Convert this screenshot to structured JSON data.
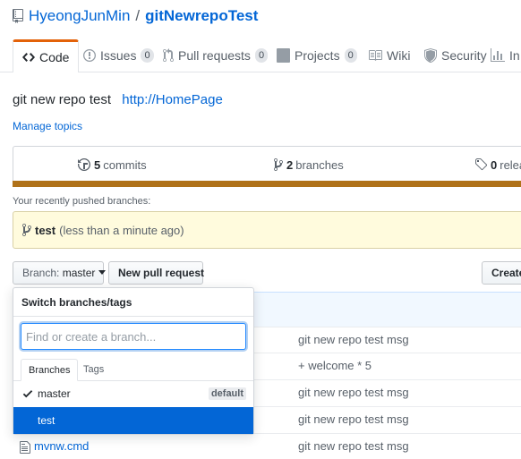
{
  "repo": {
    "owner": "HyeongJunMin",
    "separator": "/",
    "name": "gitNewrepoTest"
  },
  "tabs": [
    {
      "label": "Code",
      "count": null,
      "icon": "code-icon"
    },
    {
      "label": "Issues",
      "count": "0",
      "icon": "issue-icon"
    },
    {
      "label": "Pull requests",
      "count": "0",
      "icon": "pull-request-icon"
    },
    {
      "label": "Projects",
      "count": "0",
      "icon": "project-icon"
    },
    {
      "label": "Wiki",
      "count": null,
      "icon": "wiki-icon"
    },
    {
      "label": "Security",
      "count": null,
      "icon": "shield-icon"
    },
    {
      "label": "In",
      "count": null,
      "icon": "graph-icon"
    }
  ],
  "description": {
    "text": "git new repo test",
    "homepage": "http://HomePage",
    "manage_topics": "Manage topics"
  },
  "summary": {
    "commits_count": "5",
    "commits_label": "commits",
    "branches_count": "2",
    "branches_label": "branches",
    "releases_count": "0",
    "releases_label": "relea"
  },
  "recent": {
    "label": "Your recently pushed branches:",
    "branch": "test",
    "time": "(less than a minute ago)"
  },
  "buttons": {
    "branch_prefix": "Branch:",
    "branch_value": "master",
    "new_pr": "New pull request",
    "create": "Create"
  },
  "dropdown": {
    "title": "Switch branches/tags",
    "placeholder": "Find or create a branch...",
    "tabs": [
      "Branches",
      "Tags"
    ],
    "items": [
      {
        "name": "master",
        "badge": "default",
        "checked": true,
        "selected": false
      },
      {
        "name": "test",
        "badge": "",
        "checked": false,
        "selected": true
      }
    ]
  },
  "files": [
    {
      "name": "",
      "message": "git new repo test msg"
    },
    {
      "name": "",
      "message": "+ welcome * 5"
    },
    {
      "name": "",
      "message": "git new repo test msg"
    },
    {
      "name": "",
      "message": "git new repo test msg"
    },
    {
      "name": "mvnw.cmd",
      "message": "git new repo test msg"
    }
  ],
  "colors": {
    "accent": "#0366d6",
    "tab_highlight": "#e36209",
    "language_bar": "#b07219",
    "recent_bg": "#fffbdd"
  }
}
